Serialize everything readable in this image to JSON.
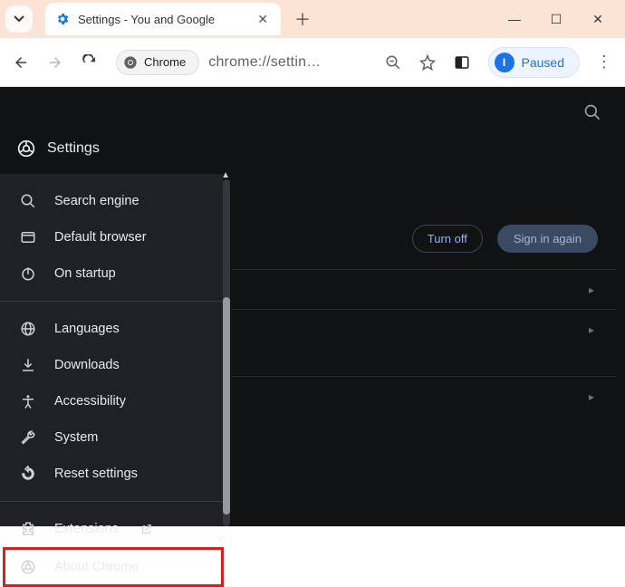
{
  "window": {
    "tab_title": "Settings - You and Google",
    "new_tab_tooltip": "New tab"
  },
  "toolbar": {
    "site_chip_label": "Chrome",
    "url_display": "chrome://settin…",
    "profile_status": "Paused",
    "avatar_initial": "I"
  },
  "settings_header": {
    "title": "Settings"
  },
  "sidebar": {
    "items": [
      {
        "icon": "search-icon",
        "label": "Search engine"
      },
      {
        "icon": "browser-icon",
        "label": "Default browser"
      },
      {
        "icon": "power-icon",
        "label": "On startup"
      },
      {
        "icon": "globe-icon",
        "label": "Languages"
      },
      {
        "icon": "download-icon",
        "label": "Downloads"
      },
      {
        "icon": "accessibility-icon",
        "label": "Accessibility"
      },
      {
        "icon": "wrench-icon",
        "label": "System"
      },
      {
        "icon": "reset-icon",
        "label": "Reset settings"
      },
      {
        "icon": "extension-icon",
        "label": "Extensions",
        "external": true
      },
      {
        "icon": "chrome-icon",
        "label": "About Chrome",
        "highlighted": true
      }
    ]
  },
  "main": {
    "turn_off_label": "Turn off",
    "sign_in_again_label": "Sign in again"
  }
}
